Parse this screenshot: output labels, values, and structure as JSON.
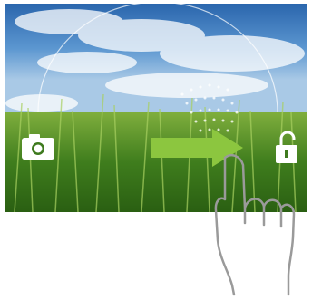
{
  "lockscreen": {
    "left_icon": "camera-icon",
    "right_icon": "unlock-icon",
    "gesture_icon": "swipe-right-arrow-icon",
    "hand_icon": "hand-pointer-icon",
    "colors": {
      "arrow": "#8cc63f",
      "sky": "#4b8ccc",
      "grass": "#3e7a1e"
    }
  }
}
